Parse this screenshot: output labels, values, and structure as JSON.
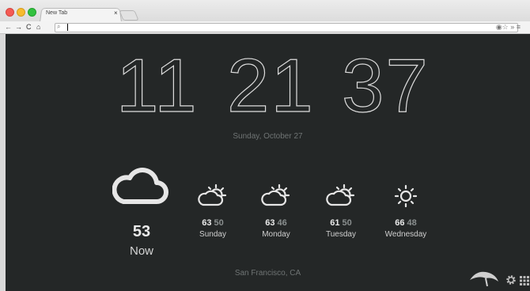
{
  "browser": {
    "tab_title": "New Tab",
    "tab_close": "×",
    "nav_back": "←",
    "nav_forward": "→",
    "nav_reload": "C",
    "nav_home": "⌂",
    "search_glyph": "⌕",
    "omnibox_value": "",
    "omnibox_right_icons": "◉☆ » ≡"
  },
  "clock": {
    "hours": "11",
    "minutes": "21",
    "seconds": "37"
  },
  "date": "Sunday, October 27",
  "current": {
    "temp": "53",
    "label": "Now",
    "icon": "cloud-moon-icon"
  },
  "forecast": [
    {
      "day": "Sunday",
      "high": "63",
      "low": "50",
      "icon": "partly-sunny-icon"
    },
    {
      "day": "Monday",
      "high": "63",
      "low": "46",
      "icon": "partly-sunny-icon"
    },
    {
      "day": "Tuesday",
      "high": "61",
      "low": "50",
      "icon": "partly-sunny-icon"
    },
    {
      "day": "Wednesday",
      "high": "66",
      "low": "48",
      "icon": "sunny-icon"
    }
  ],
  "location": "San Francisco, CA",
  "colors": {
    "background": "#242727",
    "clock_stroke": "#dcdcdc",
    "muted_text": "#6f7474"
  }
}
